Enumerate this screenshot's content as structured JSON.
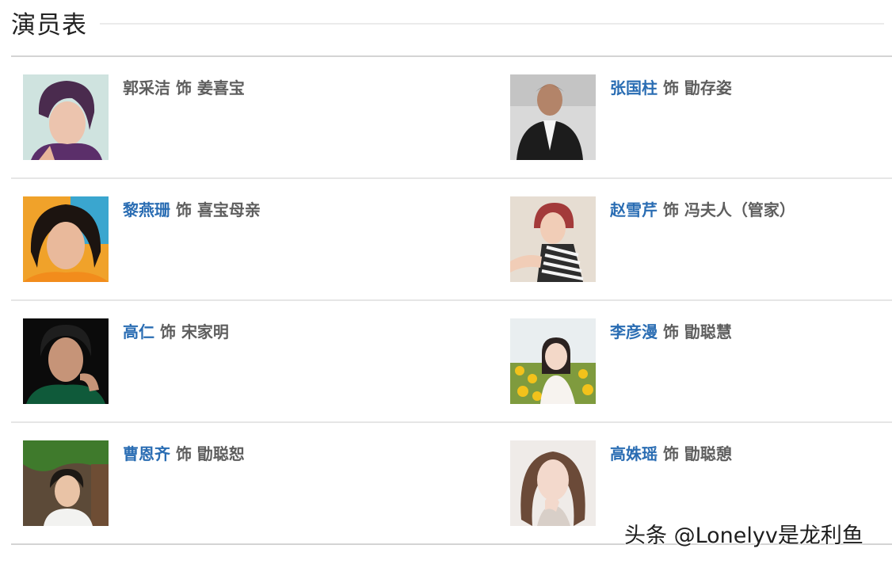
{
  "header": {
    "title": "演员表"
  },
  "cast": [
    {
      "actor": "郭采洁",
      "as": "饰",
      "role": "姜喜宝",
      "linked": false
    },
    {
      "actor": "张国柱",
      "as": "饰",
      "role": "勖存姿",
      "linked": true
    },
    {
      "actor": "黎燕珊",
      "as": "饰",
      "role": "喜宝母亲",
      "linked": true
    },
    {
      "actor": "赵雪芹",
      "as": "饰",
      "role": "冯夫人（管家）",
      "linked": true
    },
    {
      "actor": "高仁",
      "as": "饰",
      "role": "宋家明",
      "linked": true
    },
    {
      "actor": "李彦漫",
      "as": "饰",
      "role": "勖聪慧",
      "linked": true
    },
    {
      "actor": "曹恩齐",
      "as": "饰",
      "role": "勖聪恕",
      "linked": true
    },
    {
      "actor": "高姝瑶",
      "as": "饰",
      "role": "勖聪憩",
      "linked": true
    }
  ],
  "watermark": "头条 @Lonelyv是龙利鱼",
  "colors": {
    "link": "#2a6db3",
    "text": "#5e5e5e",
    "divider": "#e6e6e6"
  }
}
